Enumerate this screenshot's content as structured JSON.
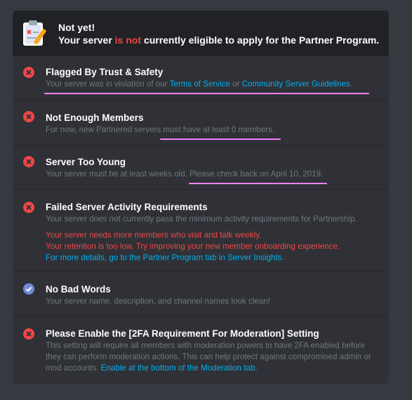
{
  "header": {
    "title": "Not yet!",
    "sub_pre": "Your server ",
    "sub_red": "is not",
    "sub_post": " currently eligible to apply for the Partner Program."
  },
  "items": [
    {
      "title": "Flagged By Trust & Safety",
      "desc_pre": "Your server was in violation of our ",
      "link1": "Terms of Service",
      "desc_mid": " or ",
      "link2": "Community Server Guidelines",
      "desc_post": ".",
      "status": "fail"
    },
    {
      "title": "Not Enough Members",
      "desc_pre": "For now, new Partnered servers ",
      "desc_hl": "must have at least 0 members.",
      "status": "fail"
    },
    {
      "title": "Server Too Young",
      "desc_pre": "Your server must be at least weeks old. ",
      "desc_hl": "Please check back on April 10, 2019.",
      "status": "fail"
    },
    {
      "title": "Failed Server Activity Requirements",
      "desc": "Your server does not currently pass the minimum activity requirements for Partnership.",
      "red1": "Your server needs more members who visit and talk weekly.",
      "red2": "Your retention is too low. Try improving your new member onboarding experience.",
      "link": "For more details, go to the Partner Program tab in Server Insights.",
      "status": "fail"
    },
    {
      "title": "No Bad Words",
      "desc": "Your server name, description, and channel names look clean!",
      "status": "pass"
    },
    {
      "title": "Please Enable the [2FA Requirement For Moderation] Setting",
      "desc": "This setting will require all members with moderation powers to have 2FA enabled before they can perform moderation actions. This can help protect against compromised admin or mod accounts. ",
      "link": "Enable at the bottom of the Moderation tab.",
      "status": "fail"
    }
  ],
  "colors": {
    "fail": "#f04747",
    "pass": "#7289da",
    "link": "#00b0f4",
    "highlight": "#f47fff"
  }
}
